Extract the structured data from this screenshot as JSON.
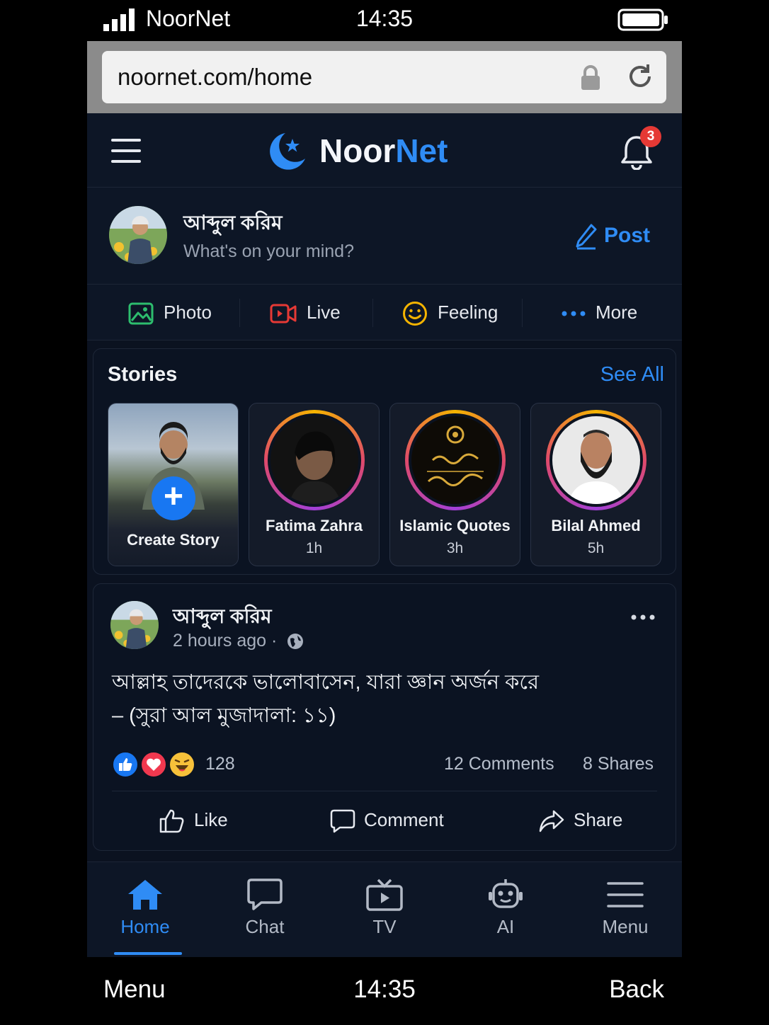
{
  "status_bar": {
    "carrier": "NoorNet",
    "time": "14:35"
  },
  "browser": {
    "url": "noornet.com/home"
  },
  "header": {
    "brand_part1": "Noor",
    "brand_part2": "Net",
    "notification_count": "3"
  },
  "composer": {
    "user_name": "আব্দুল করিম",
    "prompt": "What's on your mind?",
    "post_label": "Post"
  },
  "actions": [
    {
      "label": "Photo",
      "icon": "photo-icon",
      "color": "#2dbd6e"
    },
    {
      "label": "Live",
      "icon": "video-icon",
      "color": "#e53935"
    },
    {
      "label": "Feeling",
      "icon": "smiley-icon",
      "color": "#f5b400"
    },
    {
      "label": "More",
      "icon": "more-dots-icon",
      "color": "#2f8cf5"
    }
  ],
  "stories": {
    "title": "Stories",
    "see_all": "See All",
    "create_label": "Create Story",
    "items": [
      {
        "name": "Fatima Zahra",
        "time": "1h"
      },
      {
        "name": "Islamic Quotes",
        "time": "3h"
      },
      {
        "name": "Bilal Ahmed",
        "time": "5h"
      }
    ]
  },
  "post": {
    "author": "আব্দুল করিম",
    "time": "2 hours ago ·",
    "body_line1": "আল্লাহ তাদেরকে ভালোবাসেন, যারা জ্ঞান অর্জন করে",
    "body_line2": "– (সুরা আল মুজাদালা: ১১)",
    "reactions": [
      "like-reaction-icon",
      "love-reaction-icon",
      "haha-reaction-icon"
    ],
    "reaction_count": "128",
    "comments": "12 Comments",
    "shares": "8 Shares",
    "like_label": "Like",
    "comment_label": "Comment",
    "share_label": "Share"
  },
  "bottom_nav": [
    {
      "label": "Home",
      "icon": "home-icon",
      "active": true
    },
    {
      "label": "Chat",
      "icon": "chat-icon",
      "active": false
    },
    {
      "label": "TV",
      "icon": "tv-icon",
      "active": false
    },
    {
      "label": "AI",
      "icon": "robot-icon",
      "active": false
    },
    {
      "label": "Menu",
      "icon": "menu-icon",
      "active": false
    }
  ],
  "soft_keys": {
    "left": "Menu",
    "center": "14:35",
    "right": "Back"
  },
  "colors": {
    "accent": "#2f8cf5",
    "background": "#0b1220",
    "badge": "#e53935"
  }
}
